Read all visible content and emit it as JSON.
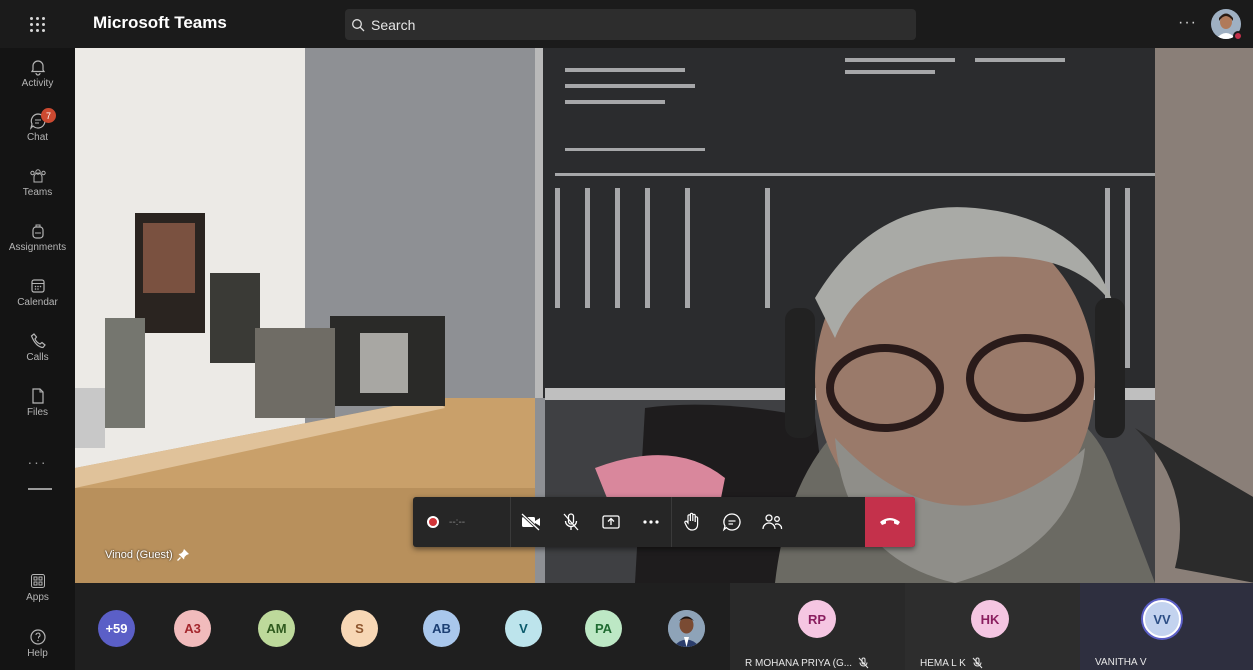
{
  "app": {
    "title": "Microsoft Teams"
  },
  "search": {
    "placeholder": "Search"
  },
  "header": {
    "more_label": "···"
  },
  "rail": {
    "items": [
      {
        "label": "Activity",
        "icon": "bell-icon"
      },
      {
        "label": "Chat",
        "icon": "chat-icon",
        "badge": "7"
      },
      {
        "label": "Teams",
        "icon": "teams-icon"
      },
      {
        "label": "Assignments",
        "icon": "backpack-icon"
      },
      {
        "label": "Calendar",
        "icon": "calendar-icon"
      },
      {
        "label": "Calls",
        "icon": "phone-icon"
      },
      {
        "label": "Files",
        "icon": "file-icon"
      }
    ],
    "more_label": "···",
    "apps_label": "Apps",
    "help_label": "Help"
  },
  "main_video": {
    "participant_name": "Vinod (Guest)"
  },
  "controls": {
    "record_timer": "--:--",
    "buttons": [
      "camera-off-icon",
      "mic-off-icon",
      "share-icon",
      "more-icon",
      "raise-hand-icon",
      "chat-icon",
      "people-icon",
      "hang-up-icon"
    ]
  },
  "participants": {
    "overflow_count": "+59",
    "chips": [
      {
        "initials": "A3",
        "bg": "#f1bbbc",
        "fg": "#a4262c"
      },
      {
        "initials": "AM",
        "bg": "#bdd99b",
        "fg": "#2f5a1e"
      },
      {
        "initials": "S",
        "bg": "#f7d7b5",
        "fg": "#8e562e"
      },
      {
        "initials": "AB",
        "bg": "#a9c7ec",
        "fg": "#1c3f73"
      },
      {
        "initials": "V",
        "bg": "#bde4ec",
        "fg": "#0b5a6b"
      },
      {
        "initials": "PA",
        "bg": "#bde8c5",
        "fg": "#1f6b31"
      }
    ],
    "tiles": [
      {
        "initials": "RP",
        "name": "R MOHANA PRIYA (G...",
        "bg": "#f5c6e2",
        "fg": "#8a1e5f",
        "muted": true
      },
      {
        "initials": "HK",
        "name": "HEMA L K",
        "bg": "#f5c6e2",
        "fg": "#8a1e5f",
        "muted": true
      },
      {
        "initials": "VV",
        "name": "VANITHA V",
        "bg": "#c3d3ef",
        "fg": "#2d4f86",
        "muted": false
      }
    ]
  },
  "colors": {
    "overflow": "#5b5fc7",
    "hangup": "#c4314b",
    "record": "#d13438"
  }
}
